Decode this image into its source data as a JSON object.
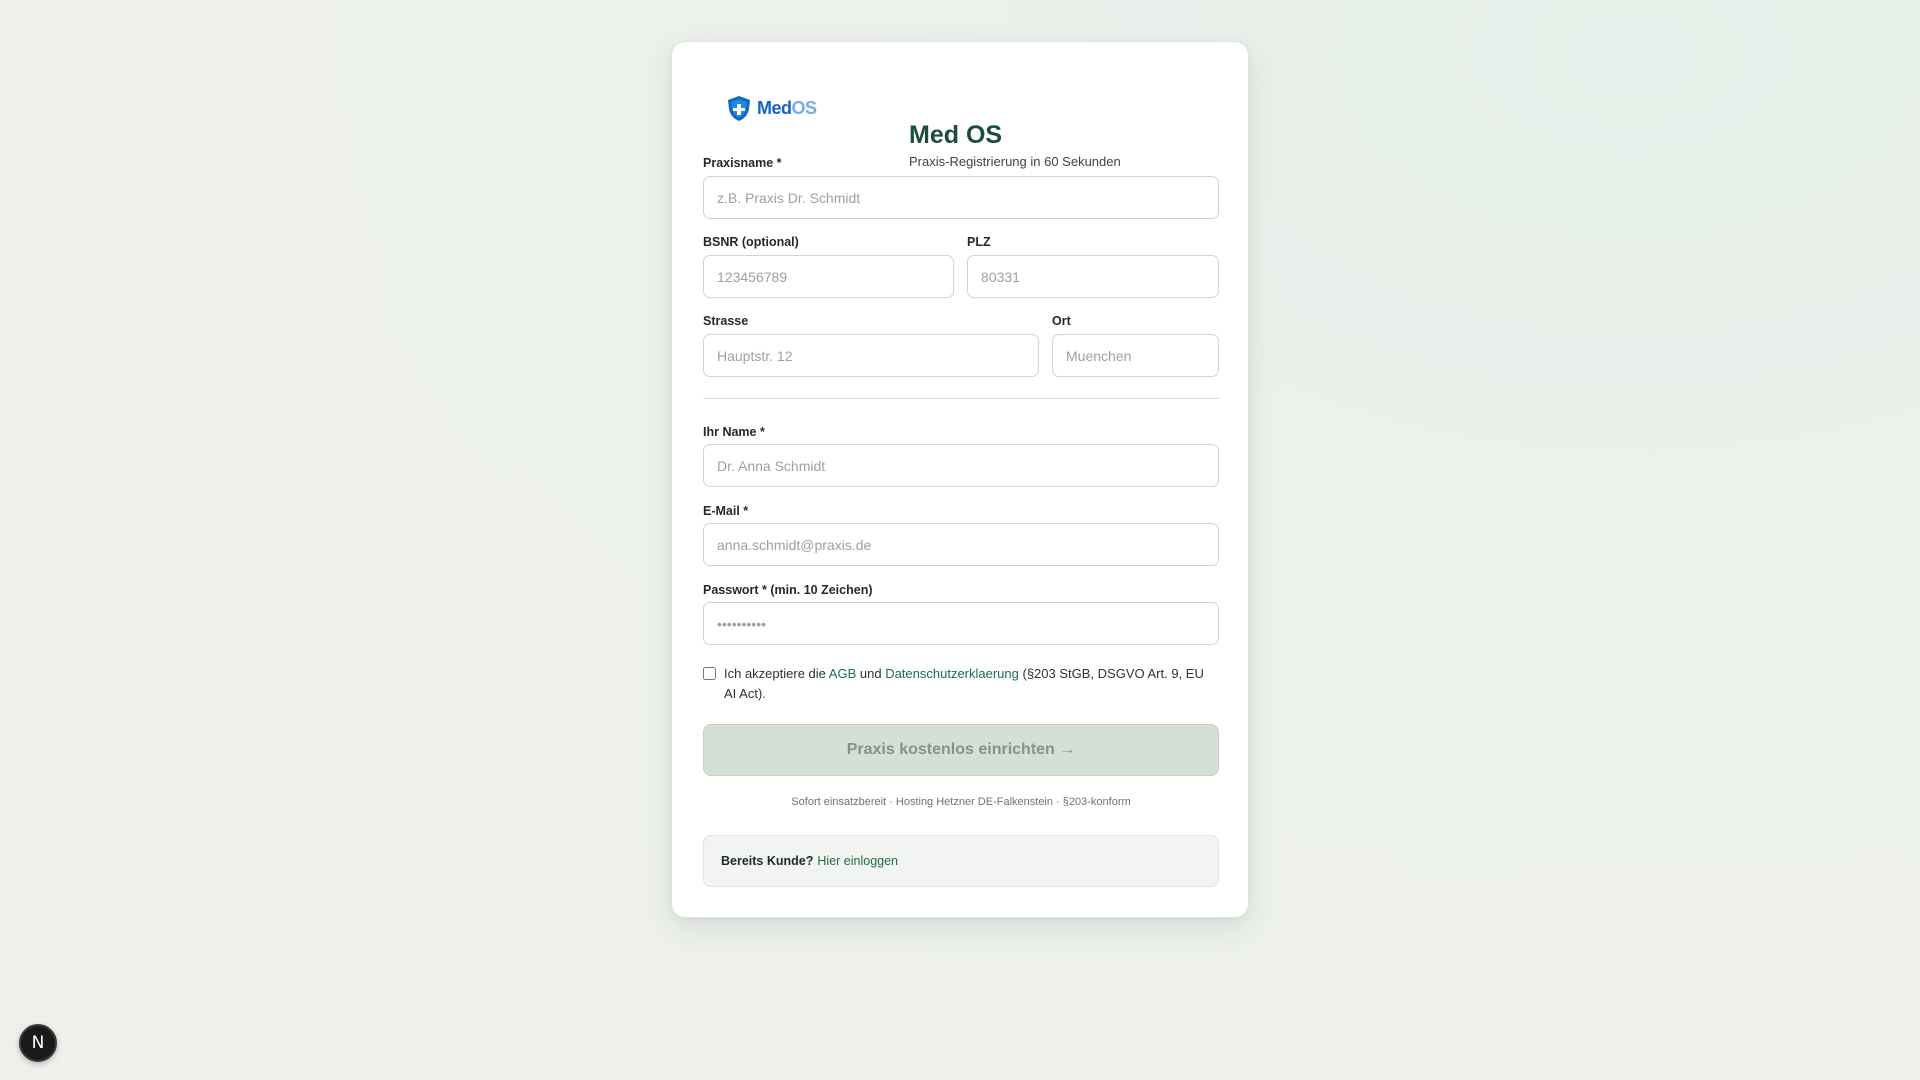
{
  "brand": {
    "logo_text_med": "Med",
    "logo_text_os": "OS",
    "title": "Med OS",
    "subtitle": "Praxis-Registrierung in 60 Sekunden",
    "primary_color": "#1b4d3e",
    "logo_blue": "#1565c0",
    "logo_icon": "shield-icon"
  },
  "form": {
    "praxisname": {
      "label": "Praxisname *",
      "placeholder": "z.B. Praxis Dr. Schmidt",
      "value": ""
    },
    "bsnr": {
      "label": "BSNR (optional)",
      "placeholder": "123456789",
      "value": ""
    },
    "plz": {
      "label": "PLZ",
      "placeholder": "80331",
      "value": ""
    },
    "strasse": {
      "label": "Strasse",
      "placeholder": "Hauptstr. 12",
      "value": ""
    },
    "ort": {
      "label": "Ort",
      "placeholder": "Muenchen",
      "value": ""
    },
    "name": {
      "label": "Ihr Name *",
      "placeholder": "Dr. Anna Schmidt",
      "value": ""
    },
    "email": {
      "label": "E-Mail *",
      "placeholder": "anna.schmidt@praxis.de",
      "value": ""
    },
    "password": {
      "label": "Passwort * (min. 10 Zeichen)",
      "placeholder": "••••••••••",
      "value": ""
    }
  },
  "consent": {
    "checked": false,
    "text_before": "Ich akzeptiere die ",
    "agb_link": "AGB",
    "text_middle": " und ",
    "privacy_link": "Datenschutzerklaerung",
    "text_after": " (§203 StGB, DSGVO Art. 9, EU AI Act)."
  },
  "submit": {
    "label": "Praxis kostenlos einrichten →",
    "disabled": true
  },
  "footnote": "Sofort einsatzbereit · Hosting Hetzner DE-Falkenstein · §203-konform",
  "login": {
    "question": "Bereits Kunde?",
    "link": "Hier einloggen"
  },
  "dev_badge": {
    "letter": "N",
    "icon": "nextjs-icon"
  }
}
